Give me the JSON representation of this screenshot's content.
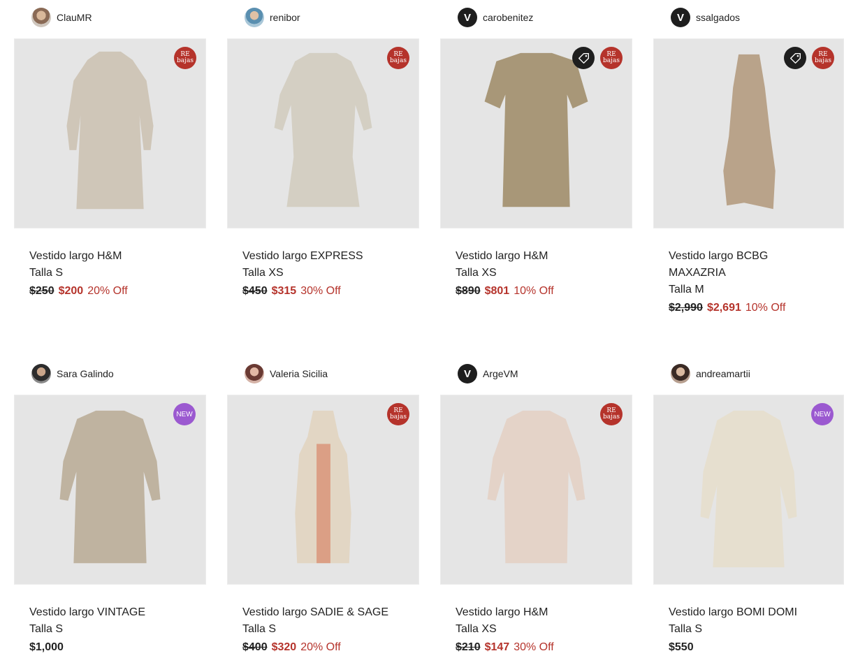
{
  "colors": {
    "accent_red": "#b5332b",
    "new_badge": "#9b59d0",
    "dark": "#1e1e1e"
  },
  "badges": {
    "rebajas_line1": "RE",
    "rebajas_line2": "bajas",
    "new": "NEW"
  },
  "products": [
    {
      "seller": "ClauMR",
      "avatar_letter": "",
      "title": "Vestido largo H&M",
      "size": "Talla S",
      "old_price": "$250",
      "price": "$200",
      "discount": "20% Off",
      "badge": "rebajas",
      "tag_icon": false,
      "dress_color": "#cfc6b8"
    },
    {
      "seller": "renibor",
      "avatar_letter": "",
      "title": "Vestido largo EXPRESS",
      "size": "Talla XS",
      "old_price": "$450",
      "price": "$315",
      "discount": "30% Off",
      "badge": "rebajas",
      "tag_icon": false,
      "dress_color": "#d4cfc3"
    },
    {
      "seller": "carobenitez",
      "avatar_letter": "V",
      "title": "Vestido largo H&M",
      "size": "Talla XS",
      "old_price": "$890",
      "price": "$801",
      "discount": "10% Off",
      "badge": "rebajas",
      "tag_icon": true,
      "dress_color": "#a89778"
    },
    {
      "seller": "ssalgados",
      "avatar_letter": "V",
      "title": "Vestido largo BCBG MAXAZRIA",
      "size": "Talla M",
      "old_price": "$2,990",
      "price": "$2,691",
      "discount": "10% Off",
      "badge": "rebajas",
      "tag_icon": true,
      "dress_color": "#b9a38a"
    },
    {
      "seller": "Sara Galindo",
      "avatar_letter": "",
      "title": "Vestido largo VINTAGE",
      "size": "Talla S",
      "old_price": "",
      "price": "$1,000",
      "discount": "",
      "badge": "new",
      "tag_icon": false,
      "dress_color": "#bfb3a0"
    },
    {
      "seller": "Valeria Sicilia",
      "avatar_letter": "",
      "title": "Vestido largo SADIE & SAGE",
      "size": "Talla S",
      "old_price": "$400",
      "price": "$320",
      "discount": "20% Off",
      "badge": "rebajas",
      "tag_icon": false,
      "dress_color": "#e2d6c4"
    },
    {
      "seller": "ArgeVM",
      "avatar_letter": "V",
      "title": "Vestido largo H&M",
      "size": "Talla XS",
      "old_price": "$210",
      "price": "$147",
      "discount": "30% Off",
      "badge": "rebajas",
      "tag_icon": false,
      "dress_color": "#e4d3c8"
    },
    {
      "seller": "andreamartii",
      "avatar_letter": "",
      "title": "Vestido largo BOMI DOMI",
      "size": "Talla S",
      "old_price": "",
      "price": "$550",
      "discount": "",
      "badge": "new",
      "tag_icon": false,
      "dress_color": "#e6dfcf"
    }
  ]
}
